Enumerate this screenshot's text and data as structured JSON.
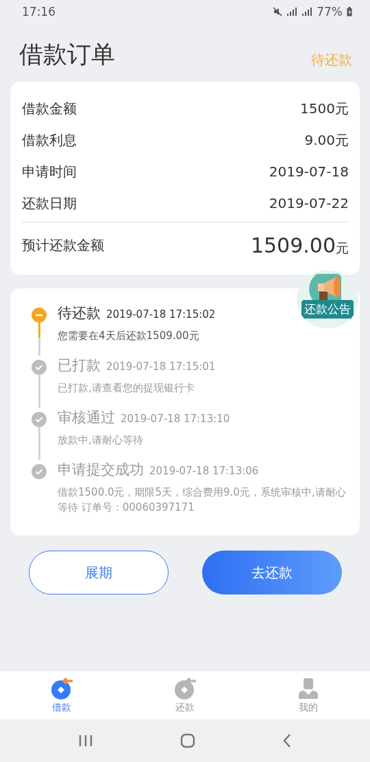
{
  "status_bar": {
    "time": "17:16",
    "battery": "77%"
  },
  "header": {
    "title": "借款订单",
    "status": "待还款"
  },
  "summary": {
    "rows": [
      {
        "label": "借款金额",
        "value": "1500元"
      },
      {
        "label": "借款利息",
        "value": "9.00元"
      },
      {
        "label": "申请时间",
        "value": "2019-07-18"
      },
      {
        "label": "还款日期",
        "value": "2019-07-22"
      }
    ],
    "total": {
      "label": "预计还款金额",
      "amount": "1509.00",
      "unit": "元"
    }
  },
  "notice_badge": {
    "label": "还款公告"
  },
  "timeline": [
    {
      "title": "待还款",
      "time": "2019-07-18 17:15:02",
      "detail": "您需要在4天后还款1509.00元",
      "current": true
    },
    {
      "title": "已打款",
      "time": "2019-07-18 17:15:01",
      "detail": "已打款,请查看您的提现银行卡",
      "current": false
    },
    {
      "title": "审核通过",
      "time": "2019-07-18 17:13:10",
      "detail": "放款中,请耐心等待",
      "current": false
    },
    {
      "title": "申请提交成功",
      "time": "2019-07-18 17:13:06",
      "detail": "借款1500.0元，期限5天，综合费用9.0元，系统审核中,请耐心等待 订单号：00060397171",
      "current": false
    }
  ],
  "buttons": [
    {
      "label": "展期",
      "kind": "outline"
    },
    {
      "label": "去还款",
      "kind": "primary"
    }
  ],
  "tabs": [
    {
      "label": "借款",
      "selected": true,
      "kind": "borrow"
    },
    {
      "label": "还款",
      "selected": false,
      "kind": "repay"
    },
    {
      "label": "我的",
      "selected": false,
      "kind": "profile"
    }
  ]
}
